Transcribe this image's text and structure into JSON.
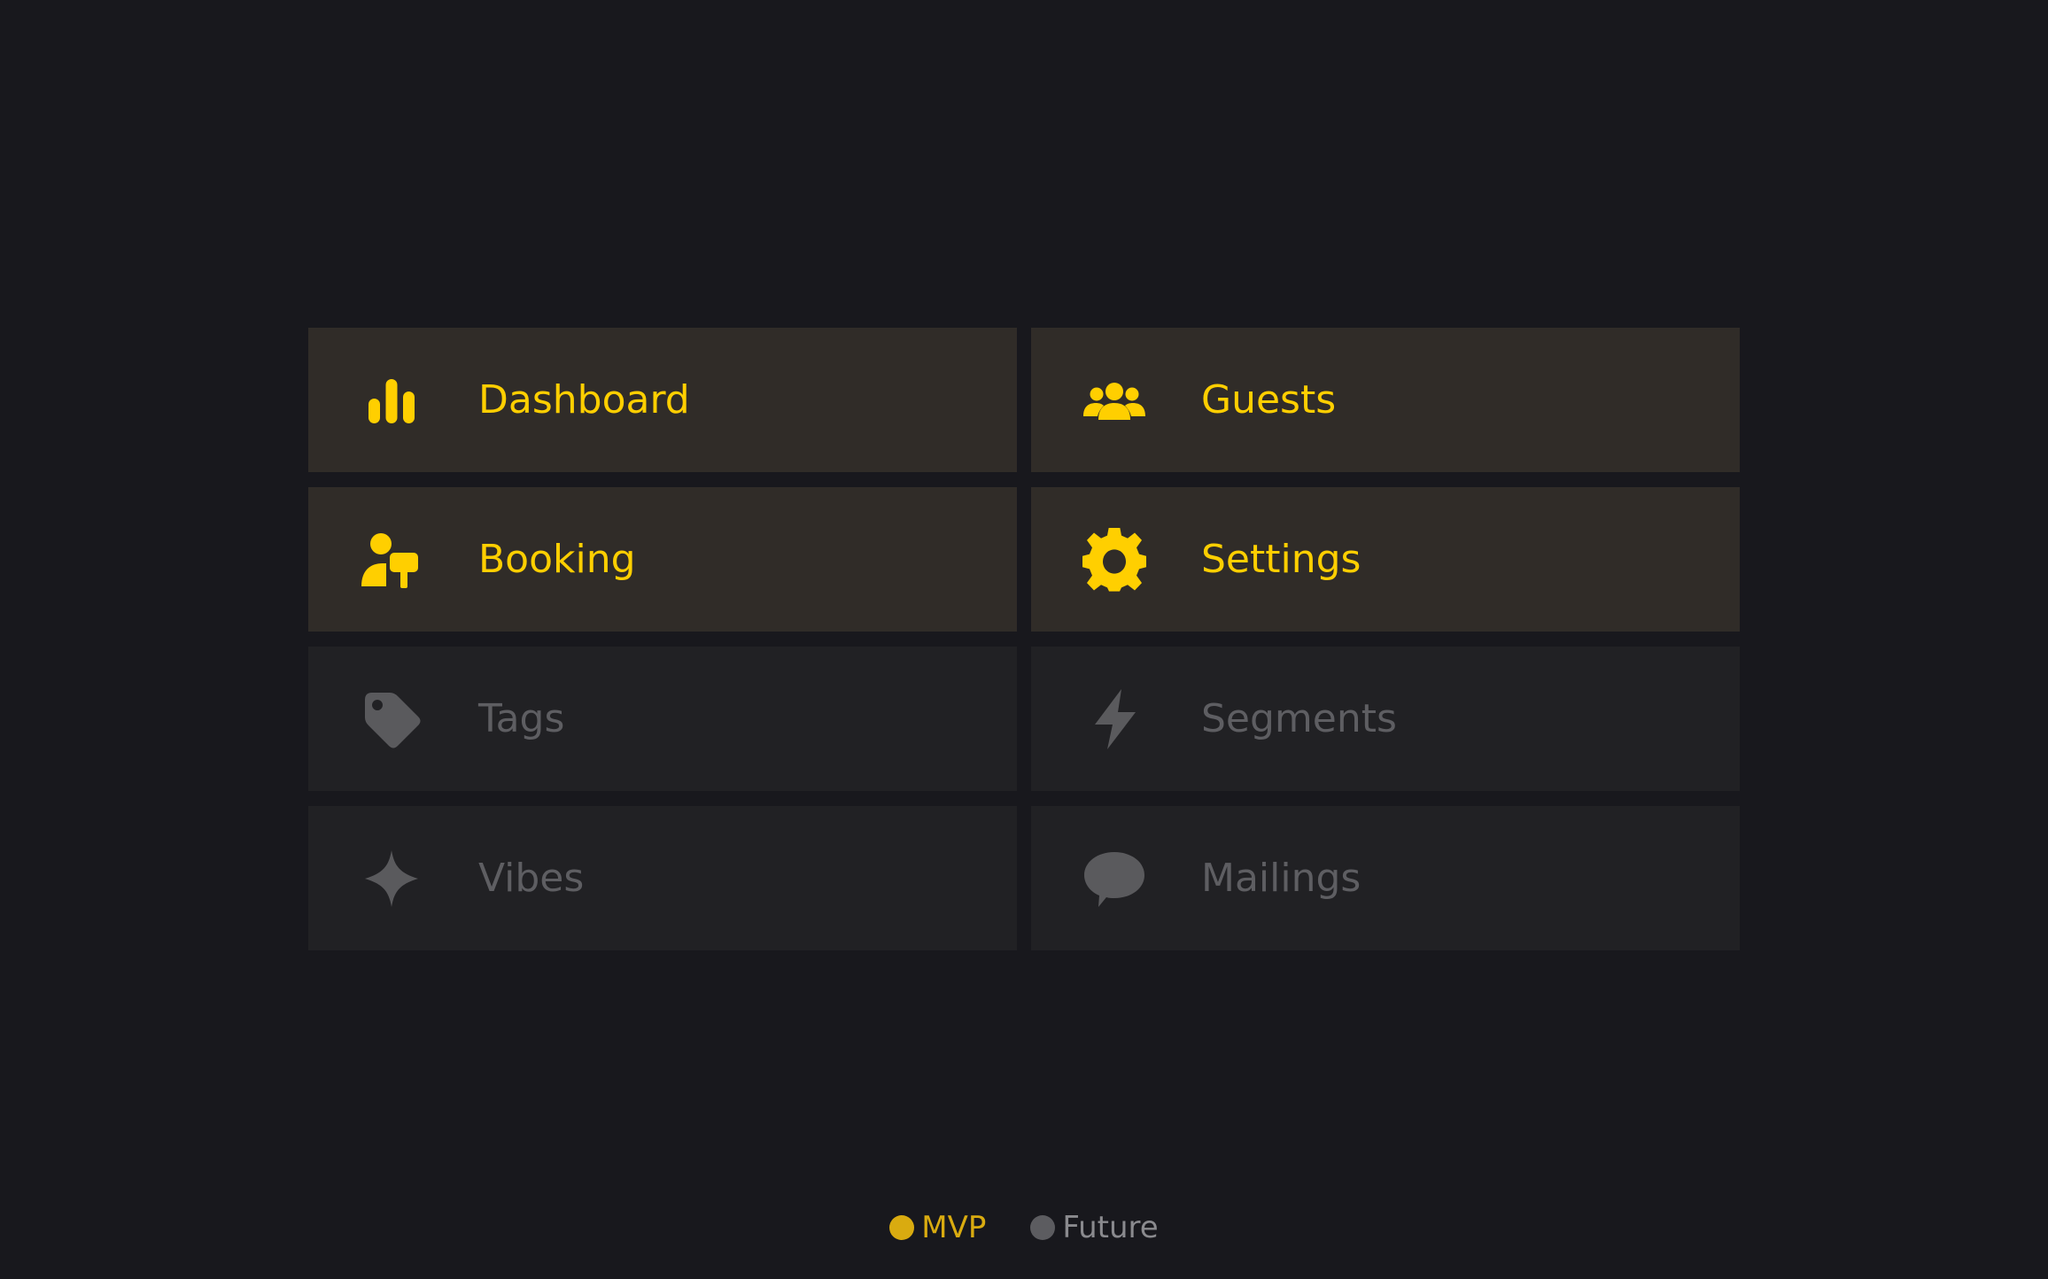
{
  "colors": {
    "background": "#18181d",
    "mvp_tile": "#302c28",
    "future_tile": "#212124",
    "mvp_accent": "#ffcf00",
    "future_text": "#5e5e62",
    "legend_mvp": "#d9ab10",
    "legend_future": "#5c5c60"
  },
  "tiles": [
    {
      "label": "Dashboard",
      "icon": "bar-chart-icon",
      "status": "mvp"
    },
    {
      "label": "Guests",
      "icon": "users-group-icon",
      "status": "mvp"
    },
    {
      "label": "Booking",
      "icon": "person-sign-icon",
      "status": "mvp"
    },
    {
      "label": "Settings",
      "icon": "gear-icon",
      "status": "mvp"
    },
    {
      "label": "Tags",
      "icon": "tag-icon",
      "status": "future"
    },
    {
      "label": "Segments",
      "icon": "lightning-icon",
      "status": "future"
    },
    {
      "label": "Vibes",
      "icon": "sparkle-icon",
      "status": "future"
    },
    {
      "label": "Mailings",
      "icon": "speech-bubble-icon",
      "status": "future"
    }
  ],
  "legend": {
    "mvp_label": "MVP",
    "future_label": "Future"
  }
}
